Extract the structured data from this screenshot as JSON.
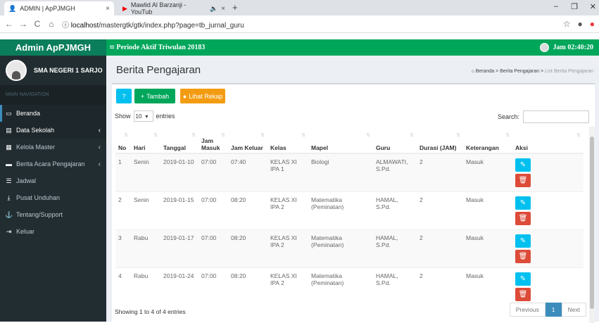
{
  "browser": {
    "tabs": [
      {
        "title": "ADMIN | ApPJMGH"
      },
      {
        "title": "Mawlid Al Barzanji - YouTub"
      }
    ],
    "url_host": "localhost",
    "url_path": "/mastergtk/gtk/index.php?page=tb_jurnal_guru"
  },
  "header": {
    "logo": "Admin ApPJMGH",
    "period": "Periode Aktif Triwulan 20183",
    "clock": "Jam 02:40:20"
  },
  "sidebar": {
    "school": "SMA NEGERI 1 SARJO",
    "nav_header": "MAIN NAVIGATION",
    "items": [
      {
        "label": "Beranda",
        "icon": "monitor-icon"
      },
      {
        "label": "Data Sekolah",
        "icon": "book-icon"
      },
      {
        "label": "Kelola Master",
        "icon": "folder-icon"
      },
      {
        "label": "Berita Acara Pengajaran",
        "icon": "briefcase-icon"
      },
      {
        "label": "Jadwal",
        "icon": "list-icon"
      },
      {
        "label": "Pusat Unduhan",
        "icon": "download-icon"
      },
      {
        "label": "Tentang/Support",
        "icon": "support-icon"
      },
      {
        "label": "Keluar",
        "icon": "logout-icon"
      }
    ]
  },
  "page": {
    "title": "Berita Pengajaran",
    "breadcrumb": [
      "Beranda",
      "Berita Pengajaran",
      "List Berita Pengajaran"
    ]
  },
  "toolbar": {
    "add_label": "Tambah",
    "recap_label": "Lihat Rekap"
  },
  "table_controls": {
    "show": "Show",
    "length": "10",
    "entries": "entries",
    "search": "Search:"
  },
  "table": {
    "headers": [
      "No",
      "Hari",
      "Tanggal",
      "Jam Masuk",
      "Jam Keluar",
      "Kelas",
      "Mapel",
      "Guru",
      "Durasi (JAM)",
      "Keterangan",
      "Aksi"
    ],
    "rows": [
      [
        "1",
        "Senin",
        "2019-01-10",
        "07:00",
        "07:40",
        "KELAS XI IPA 1",
        "Biologi",
        "ALMAWATI, S.Pd.",
        "2",
        "Masuk"
      ],
      [
        "2",
        "Senin",
        "2019-01-15",
        "07:00",
        "08:20",
        "KELAS XI IPA 2",
        "Matematika (Peminatan)",
        "HAMAL, S.Pd.",
        "2",
        "Masuk"
      ],
      [
        "3",
        "Rabu",
        "2019-01-17",
        "07:00",
        "08:20",
        "KELAS XI IPA 2",
        "Matematika (Peminatan)",
        "HAMAL, S.Pd.",
        "2",
        "Masuk"
      ],
      [
        "4",
        "Rabu",
        "2019-01-24",
        "07:00",
        "08:20",
        "KELAS XI IPA 2",
        "Matematika (Peminatan)",
        "HAMAL, S.Pd.",
        "2",
        "Masuk"
      ]
    ]
  },
  "footer": {
    "info": "Showing 1 to 4 of 4 entries",
    "prev": "Previous",
    "page": "1",
    "next": "Next"
  },
  "colors": {
    "header_green": "#00a65a",
    "sidebar": "#222d32",
    "edit": "#00c0ef",
    "delete": "#dd4b39",
    "recap": "#f39c12"
  }
}
